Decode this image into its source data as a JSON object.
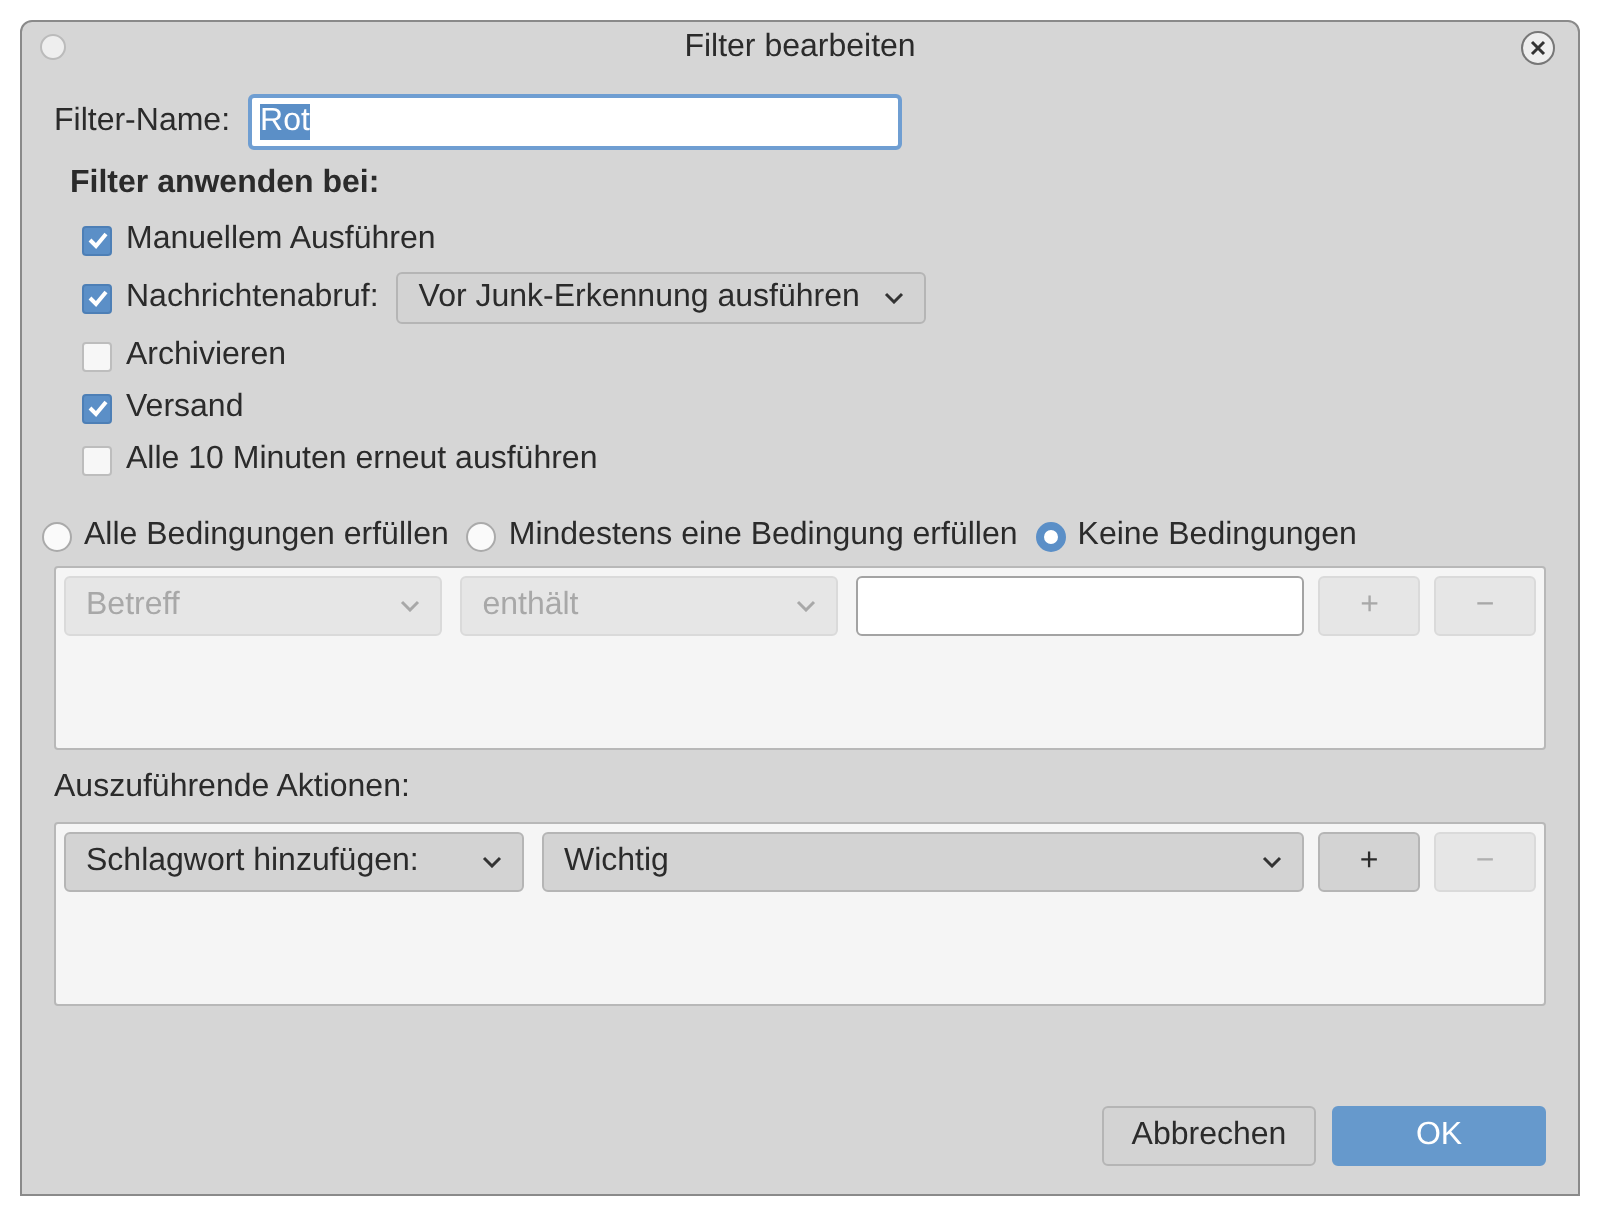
{
  "window": {
    "title": "Filter bearbeiten"
  },
  "filter_name": {
    "label": "Filter-Name:",
    "value": "Rot",
    "text_selected": true
  },
  "apply_heading": "Filter anwenden bei:",
  "apply_options": [
    {
      "label": "Manuellem Ausführen",
      "checked": true
    },
    {
      "label": "Nachrichtenabruf:",
      "checked": true,
      "dropdown": "Vor Junk-Erkennung ausführen"
    },
    {
      "label": "Archivieren",
      "checked": false
    },
    {
      "label": "Versand",
      "checked": true
    },
    {
      "label": "Alle 10 Minuten erneut ausführen",
      "checked": false
    }
  ],
  "match_options": [
    {
      "label": "Alle Bedingungen erfüllen",
      "selected": false
    },
    {
      "label": "Mindestens eine Bedingung erfüllen",
      "selected": false
    },
    {
      "label": "Keine Bedingungen",
      "selected": true
    }
  ],
  "conditions": {
    "disabled": true,
    "rows": [
      {
        "field": "Betreff",
        "operator": "enthält",
        "add": "+",
        "remove": "−"
      }
    ]
  },
  "actions_label": "Auszuführende Aktionen:",
  "actions": [
    {
      "action": "Schlagwort hinzufügen:",
      "value": "Wichtig",
      "add": "+",
      "remove": "−",
      "remove_disabled": true
    }
  ],
  "buttons": [
    {
      "label": "Abbrechen",
      "default": false
    },
    {
      "label": "OK",
      "default": true
    }
  ]
}
